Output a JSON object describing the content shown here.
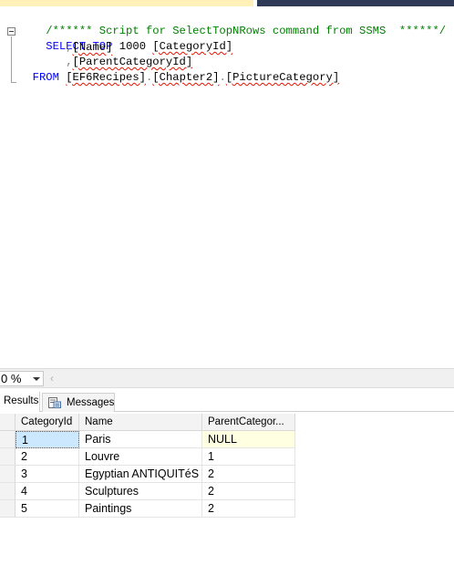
{
  "editor": {
    "line1_comment": "/****** Script for SelectTopNRows command from SSMS  ******/",
    "line2_select": "SELECT",
    "line2_top": "TOP",
    "line2_num": " 1000 ",
    "line2_col": "[CategoryId]",
    "line3_comma": ",",
    "line3_col": "[Name]",
    "line4_comma": ",",
    "line4_col": "[ParentCategoryId]",
    "line5_from": "FROM",
    "line5_db": "[EF6Recipes]",
    "line5_dot1": ".",
    "line5_schema": "[Chapter2]",
    "line5_dot2": ".",
    "line5_table": "[PictureCategory]"
  },
  "zoom": {
    "value": "0 %"
  },
  "results_tabs": {
    "results_label": "Results",
    "messages_label": "Messages"
  },
  "grid": {
    "columns": [
      "CategoryId",
      "Name",
      "ParentCategor..."
    ],
    "rows": [
      {
        "id": "1",
        "name": "Paris",
        "parent": "NULL"
      },
      {
        "id": "2",
        "name": "Louvre",
        "parent": "1"
      },
      {
        "id": "3",
        "name": "Egyptian ANTIQUITéS",
        "parent": "2"
      },
      {
        "id": "4",
        "name": "Sculptures",
        "parent": "2"
      },
      {
        "id": "5",
        "name": "Paintings",
        "parent": "2"
      }
    ]
  },
  "colors": {
    "keyword": "#0000ff",
    "comment": "#008000",
    "selection": "#cce8ff",
    "null_highlight": "#ffffe1"
  }
}
